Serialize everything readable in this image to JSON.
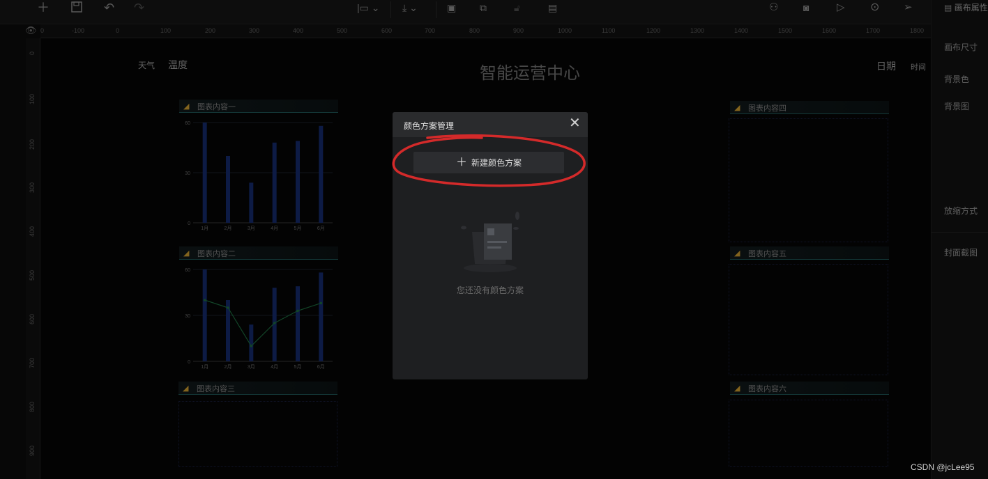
{
  "toolbar": {
    "icons": [
      "plus-icon",
      "save-icon",
      "undo-icon",
      "redo-icon",
      "align-icon",
      "download-icon",
      "layout-icon",
      "copy-icon",
      "lock-icon",
      "note-icon",
      "user-icon",
      "camera-icon",
      "play-icon",
      "upload-icon",
      "send-icon"
    ]
  },
  "right_panel": {
    "title": "画布属性",
    "items": [
      "画布尺寸",
      "背景色",
      "背景图",
      "放缩方式",
      "封面截图"
    ]
  },
  "ruler": {
    "top": [
      "0",
      "-100",
      "0",
      "100",
      "200",
      "300",
      "400",
      "500",
      "600",
      "700",
      "800",
      "900",
      "1000",
      "1100",
      "1200",
      "1300",
      "1400",
      "1500",
      "1600",
      "1700",
      "1800"
    ],
    "left": [
      "0",
      "100",
      "200",
      "300",
      "400",
      "500",
      "600",
      "700",
      "800",
      "900"
    ]
  },
  "dashboard": {
    "title": "智能运营中心",
    "weather": "天气",
    "temperature": "温度",
    "date": "日期",
    "time": "时间",
    "panels": [
      "图表内容一",
      "图表内容二",
      "图表内容三",
      "图表内容四",
      "图表内容五",
      "图表内容六"
    ]
  },
  "chart_data": [
    {
      "type": "bar",
      "categories": [
        "1月",
        "2月",
        "3月",
        "4月",
        "5月",
        "6月"
      ],
      "values": [
        60,
        40,
        24,
        48,
        49,
        58
      ],
      "yticks": [
        "0",
        "30",
        "60"
      ],
      "ylim": [
        0,
        60
      ]
    },
    {
      "type": "bar",
      "categories": [
        "1月",
        "2月",
        "3月",
        "4月",
        "5月",
        "6月"
      ],
      "series": [
        {
          "kind": "bar",
          "values": [
            60,
            40,
            24,
            48,
            49,
            58
          ]
        },
        {
          "kind": "line",
          "values": [
            40,
            35,
            10,
            25,
            33,
            38
          ]
        }
      ],
      "yticks": [
        "0",
        "30",
        "60"
      ],
      "ylim": [
        0,
        60
      ]
    }
  ],
  "modal": {
    "title": "颜色方案管理",
    "close": "✕",
    "new_button": "新建颜色方案",
    "empty_text": "您还没有颜色方案"
  },
  "watermark": "CSDN @jcLee95",
  "colors": {
    "bar": "#142a6b",
    "line": "#1d6b3e",
    "annotation": "#d42a2a"
  }
}
